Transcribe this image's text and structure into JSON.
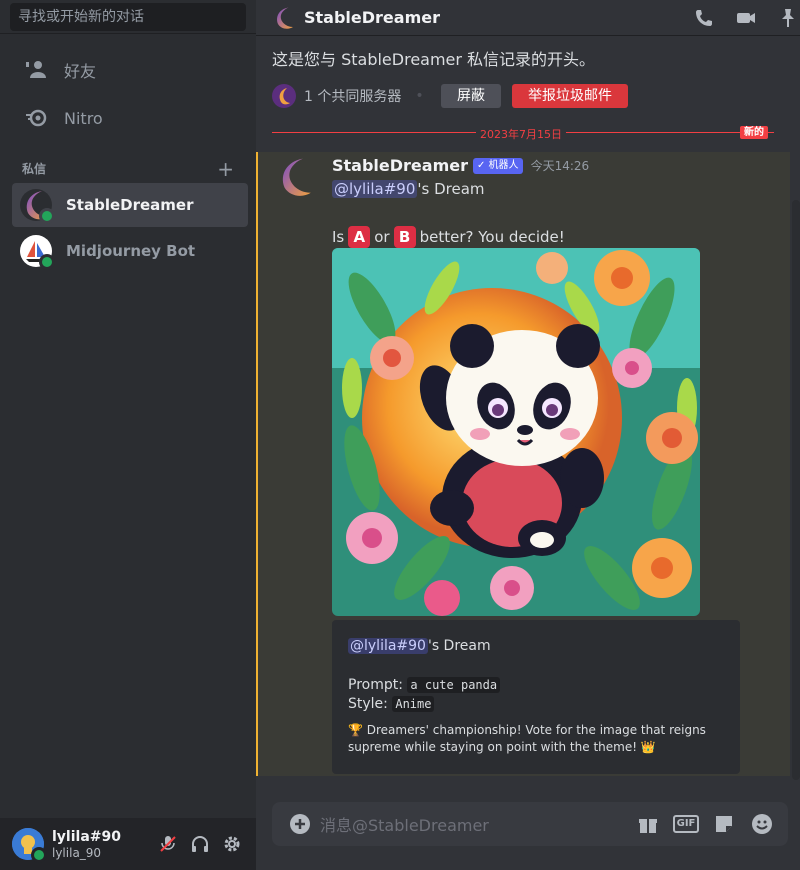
{
  "sidebar": {
    "search_placeholder": "寻找或开始新的对话",
    "nav": [
      {
        "label": "好友",
        "icon": "friends-icon"
      },
      {
        "label": "Nitro",
        "icon": "nitro-icon"
      }
    ],
    "dm_header": "私信",
    "dm_add": "+",
    "dms": [
      {
        "name": "StableDreamer",
        "active": true,
        "status": "online"
      },
      {
        "name": "Midjourney Bot",
        "active": false,
        "status": "online"
      }
    ]
  },
  "user_panel": {
    "username": "lylila#90",
    "tag": "lylila_90"
  },
  "channel": {
    "title": "StableDreamer",
    "intro": "这是您与 StableDreamer 私信记录的开头。",
    "mutual_servers": "1 个共同服务器",
    "block_label": "屏蔽",
    "report_label": "举报垃圾邮件",
    "date_divider": "2023年7月15日",
    "new_badge": "新的"
  },
  "message": {
    "author": "StableDreamer",
    "bot_tag": "✓ 机器人",
    "timestamp": "今天14:26",
    "mention": "@lylila#90",
    "dream_suffix": "'s Dream",
    "question_prefix": "Is",
    "option_a": "A",
    "or_text": "or",
    "option_b": "B",
    "question_suffix": "better? You decide!",
    "image_alt": "anime panda with flowers",
    "embed": {
      "mention": "@lylila#90",
      "dream_suffix": "'s Dream",
      "prompt_label": "Prompt:",
      "prompt_value": "a cute panda",
      "style_label": "Style:",
      "style_value": "Anime",
      "champion_text": "🏆 Dreamers' championship! Vote for the image that reigns supreme while staying on point with the theme! 👑"
    }
  },
  "composer": {
    "placeholder": "消息@StableDreamer",
    "gif_label": "GIF"
  },
  "colors": {
    "accent_red": "#f23f43",
    "bot_blue": "#5865f2",
    "online_green": "#23a55a",
    "highlight_gold": "#f0b232"
  }
}
